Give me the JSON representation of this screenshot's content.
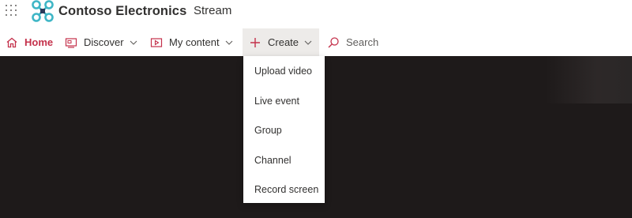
{
  "header": {
    "brand_name": "Contoso Electronics",
    "app_name": "Stream",
    "logo_icon": "contoso-logo-icon",
    "waffle_icon": "app-launcher-icon"
  },
  "nav": {
    "home": "Home",
    "discover": "Discover",
    "my_content": "My content",
    "create": "Create",
    "search_placeholder": "Search"
  },
  "create_menu": {
    "items": [
      "Upload video",
      "Live event",
      "Group",
      "Channel",
      "Record screen"
    ]
  },
  "colors": {
    "accent": "#c4314b",
    "logo": "#3fb6c6",
    "stage": "#1e1a1a"
  }
}
